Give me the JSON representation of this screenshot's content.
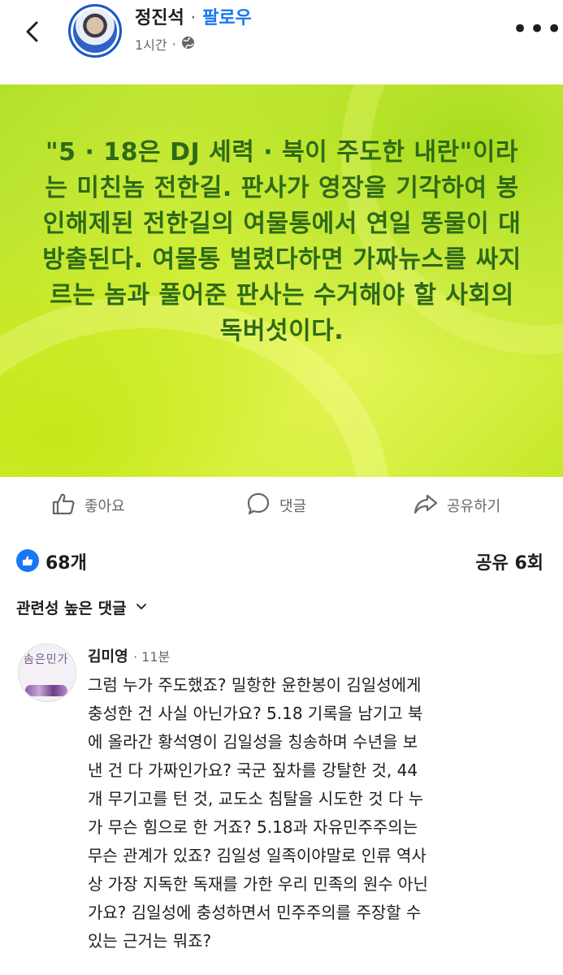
{
  "header": {
    "author": "정진석",
    "separator": "·",
    "follow_label": "팔로우",
    "time": "1시간",
    "audience_icon": "globe-icon",
    "more_label": "•••"
  },
  "post": {
    "text": "\"5 · 18은 DJ 세력 · 북이 주도한 내란\"이라는 미친놈 전한길. 판사가 영장을 기각하여 봉인해제된 전한길의 여물통에서 연일 똥물이 대방출된다. 여물통 벌렸다하면 가짜뉴스를 싸지르는 놈과 풀어준 판사는 수거해야 할 사회의 독버섯이다.",
    "background_color": "#c8e829",
    "text_color": "#2e6a18"
  },
  "actions": {
    "like_label": "좋아요",
    "comment_label": "댓글",
    "share_label": "공유하기"
  },
  "stats": {
    "likes": "68개",
    "shares": "공유 6회"
  },
  "comments_sort": {
    "label": "관련성 높은 댓글"
  },
  "comment": {
    "avatar_text": "솜은민가",
    "author": "김미영",
    "time": "· 11분",
    "text": "그럼 누가 주도했죠? 밀항한 윤한봉이 김일성에게\n충성한 건 사실 아닌가요? 5.18 기록을 남기고 북\n에 올라간 황석영이 김일성을 칭송하며 수년을 보\n낸 건 다 가짜인가요? 국군 짚차를 강탈한 것, 44\n개 무기고를 턴 것, 교도소 침탈을 시도한 것 다 누\n가 무슨 힘으로 한 거죠? 5.18과 자유민주주의는\n무슨 관계가 있죠? 김일성 일족이야말로 인류 역사\n상 가장 지독한 독재를 가한 우리 민족의 원수 아닌\n가요? 김일성에 충성하면서 민주주의를  주장할 수\n있는 근거는 뭐죠?"
  },
  "colors": {
    "accent": "#1877f2",
    "secondary_text": "#65676b"
  }
}
